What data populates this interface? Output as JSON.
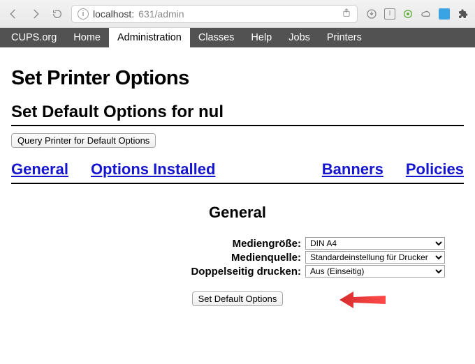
{
  "browser": {
    "url_host": "localhost:",
    "url_port_path": "631/admin"
  },
  "tabs": {
    "items": [
      {
        "label": "CUPS.org"
      },
      {
        "label": "Home"
      },
      {
        "label": "Administration"
      },
      {
        "label": "Classes"
      },
      {
        "label": "Help"
      },
      {
        "label": "Jobs"
      },
      {
        "label": "Printers"
      }
    ],
    "active_index": 2
  },
  "page": {
    "title": "Set Printer Options",
    "subtitle": "Set Default Options for nul",
    "query_button": "Query Printer for Default Options",
    "anchors": {
      "general": "General",
      "options_installed": "Options Installed",
      "banners": "Banners",
      "policies": "Policies"
    },
    "section_title": "General",
    "fields": {
      "media_size": {
        "label": "Mediengröße:",
        "value": "DIN A4"
      },
      "media_source": {
        "label": "Medienquelle:",
        "value": "Standardeinstellung für Drucker"
      },
      "duplex": {
        "label": "Doppelseitig drucken:",
        "value": "Aus (Einseitig)"
      }
    },
    "submit_button": "Set Default Options"
  }
}
